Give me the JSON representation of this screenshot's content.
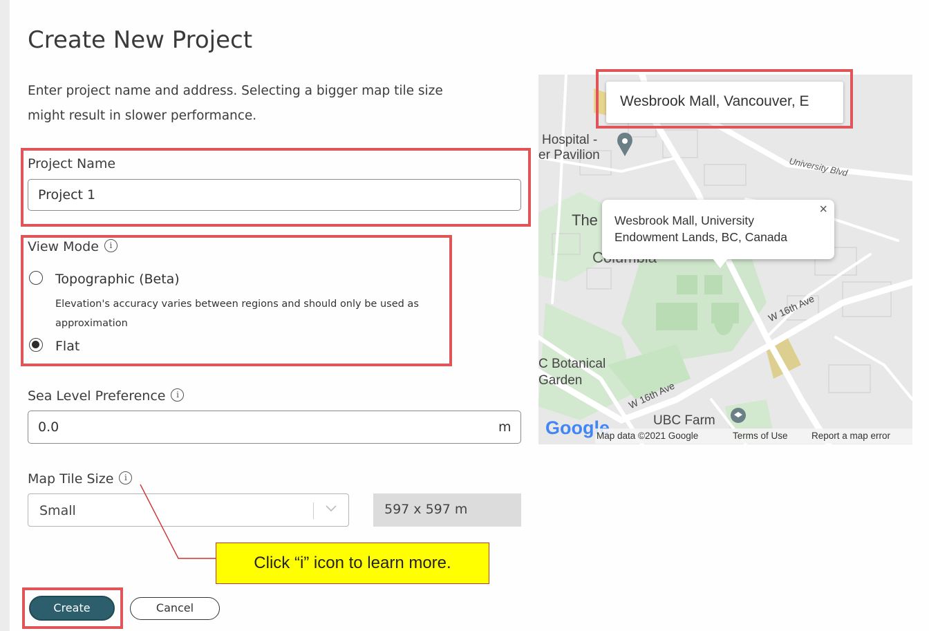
{
  "dialog": {
    "title": "Create New Project",
    "description": "Enter project name and address. Selecting a bigger map tile size might result in slower performance."
  },
  "project_name": {
    "label": "Project Name",
    "value": "Project 1"
  },
  "view_mode": {
    "label": "View Mode",
    "options": [
      {
        "label": "Topographic (Beta)",
        "selected": false,
        "help": "Elevation's accuracy varies between regions and should only be used as approximation"
      },
      {
        "label": "Flat",
        "selected": true
      }
    ]
  },
  "sea_level": {
    "label": "Sea Level Preference",
    "value": "0.0",
    "unit": "m"
  },
  "map_tile": {
    "label": "Map Tile Size",
    "selected": "Small",
    "dimensions": "597 x 597 m"
  },
  "buttons": {
    "create": "Create",
    "cancel": "Cancel"
  },
  "map": {
    "search_value": "Wesbrook Mall, Vancouver, E",
    "popup_text": "Wesbrook Mall, University Endowment Lands, BC, Canada",
    "popup_close": "×",
    "labels": {
      "hospital": "Hospital -",
      "pavilion": "er Pavilion",
      "university_blvd": "University Blvd",
      "the": "The",
      "columbia": "Columbia",
      "w16th_right": "W 16th Ave",
      "w16th_left": "W 16th Ave",
      "botanical": "C Botanical",
      "garden": "Garden",
      "ubc_farm": "UBC Farm"
    },
    "footer": {
      "logo": "Google",
      "data": "Map data ©2021 Google",
      "terms": "Terms of Use",
      "report": "Report a map error"
    }
  },
  "annotation": {
    "callout": "Click “i” icon to learn more."
  },
  "icons": {
    "info": "i"
  },
  "colors": {
    "highlight_border": "#e05558",
    "primary_button": "#2c5f6b",
    "callout_bg": "#ffff00"
  }
}
